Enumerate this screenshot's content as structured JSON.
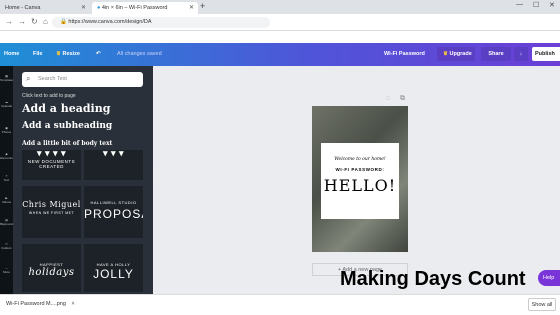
{
  "browser": {
    "tabs": [
      {
        "label": "Home - Canva"
      },
      {
        "label": "4in × 6in – Wi-Fi Password"
      }
    ],
    "url": "https://www.canva.com/design/DA"
  },
  "toolbar": {
    "home": "Home",
    "file": "File",
    "resize": "Resize",
    "saved": "All changes saved",
    "doc_title": "Wi-Fi Password",
    "upgrade": "Upgrade",
    "share": "Share",
    "publish": "Publish"
  },
  "rail": {
    "items": [
      "Templates",
      "Uploads",
      "Photos",
      "Elements",
      "Text",
      "Videos",
      "Bkground",
      "Folders",
      "More"
    ]
  },
  "panel": {
    "search_placeholder": "Search Text",
    "hint": "Click text to add to page",
    "heading": "Add a heading",
    "subheading": "Add a subheading",
    "body": "Add a little bit of body text",
    "tiles": [
      {
        "line1": "NEW DOCUMENTS",
        "line2": "CREATED"
      },
      {
        "line1": "",
        "line2": ""
      },
      {
        "line1": "Chris Miguel",
        "line2": "WHEN WE FIRST MET"
      },
      {
        "line1": "HALLIWELL STUDIO",
        "line2": "PROPOSAL"
      },
      {
        "line1": "HAPPIEST",
        "line2": "holidays"
      },
      {
        "line1": "HAVE A HOLLY",
        "line2": "JOLLY"
      }
    ]
  },
  "design": {
    "welcome": "Welcome to our home!",
    "wifi": "WI-FI PASSWORD:",
    "password": "HELLO!",
    "add_page": "+ Add a new page"
  },
  "help": "Help",
  "watermark": "Making Days Count",
  "downloads": {
    "file": "Wi-Fi Password M....png",
    "show_all": "Show all"
  }
}
